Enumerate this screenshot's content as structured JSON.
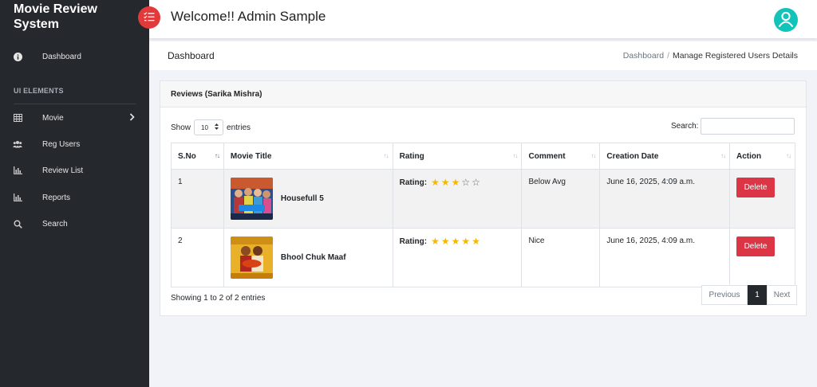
{
  "sidebar": {
    "brand": "Movie Review System",
    "items": [
      {
        "label": "Dashboard",
        "icon": "info-icon"
      },
      {
        "label": "Movie",
        "icon": "table-icon"
      },
      {
        "label": "Reg Users",
        "icon": "users-icon"
      },
      {
        "label": "Review List",
        "icon": "chart-icon"
      },
      {
        "label": "Reports",
        "icon": "chart-icon"
      },
      {
        "label": "Search",
        "icon": "search-icon"
      }
    ],
    "section_title": "UI ELEMENTS"
  },
  "header": {
    "title": "Welcome!! Admin Sample"
  },
  "pagebar": {
    "title": "Dashboard",
    "breadcrumb": {
      "link": "Dashboard",
      "separator": "/",
      "active": "Manage Registered Users Details"
    }
  },
  "card": {
    "title": "Reviews (Sarika Mishra)",
    "show_label": "Show",
    "entries_value": "10",
    "entries_label": "entries",
    "search_label": "Search:",
    "search_value": "",
    "columns": [
      "S.No",
      "Movie Title",
      "Rating",
      "Comment",
      "Creation Date",
      "Action"
    ],
    "rating_label": "Rating:",
    "rows": [
      {
        "sno": "1",
        "movie": "Housefull 5",
        "rating": 3,
        "rating_max": 5,
        "comment": "Below Avg",
        "date": "June 16, 2025, 4:09 a.m.",
        "action": "Delete"
      },
      {
        "sno": "2",
        "movie": "Bhool Chuk Maaf",
        "rating": 5,
        "rating_max": 5,
        "comment": "Nice",
        "date": "June 16, 2025, 4:09 a.m.",
        "action": "Delete"
      }
    ],
    "info": "Showing 1 to 2 of 2 entries",
    "pagination": {
      "previous": "Previous",
      "current": "1",
      "next": "Next"
    }
  },
  "colors": {
    "sidebar_bg": "#25282d",
    "toggle_bg": "#e23a3a",
    "avatar_bg": "#11c3b9",
    "delete_bg": "#dc3545",
    "star_on": "#f5b800"
  }
}
